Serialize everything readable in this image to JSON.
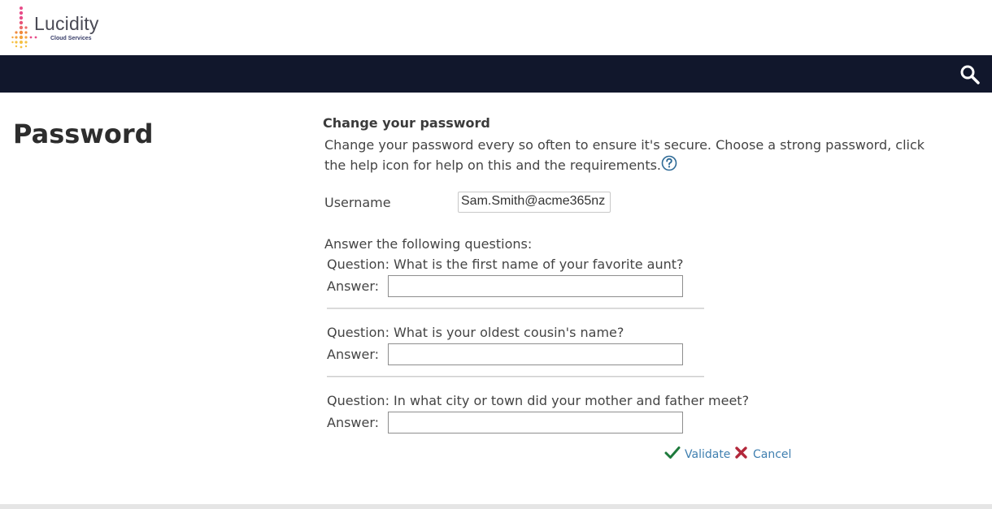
{
  "brand": {
    "name": "Lucidity",
    "tagline": "Cloud Services",
    "accent_colors": [
      "#e84c89",
      "#f08a3c",
      "#f5c043"
    ]
  },
  "navbar": {
    "background": "#11172c",
    "search_icon": "search-icon"
  },
  "page": {
    "title": "Password"
  },
  "form": {
    "section_title": "Change your password",
    "description": "Change your password every so often to ensure it's secure. Choose a strong password, click the help icon for help on this and the requirements.",
    "help_icon": "question-circle-icon",
    "username_label": "Username",
    "username_value": "Sam.Smith@acme365nz",
    "questions_intro": "Answer the following questions:",
    "questions": [
      {
        "question": "Question: What is the first name of your favorite aunt?",
        "answer_label": "Answer:",
        "answer_value": ""
      },
      {
        "question": "Question: What is your oldest cousin's name?",
        "answer_label": "Answer:",
        "answer_value": ""
      },
      {
        "question": "Question: In what city or town did your mother and father meet?",
        "answer_label": "Answer:",
        "answer_value": ""
      }
    ]
  },
  "actions": {
    "validate_label": "Validate",
    "validate_icon": "check-icon",
    "cancel_label": "Cancel",
    "cancel_icon": "close-icon",
    "link_color": "#3f7fb0"
  }
}
